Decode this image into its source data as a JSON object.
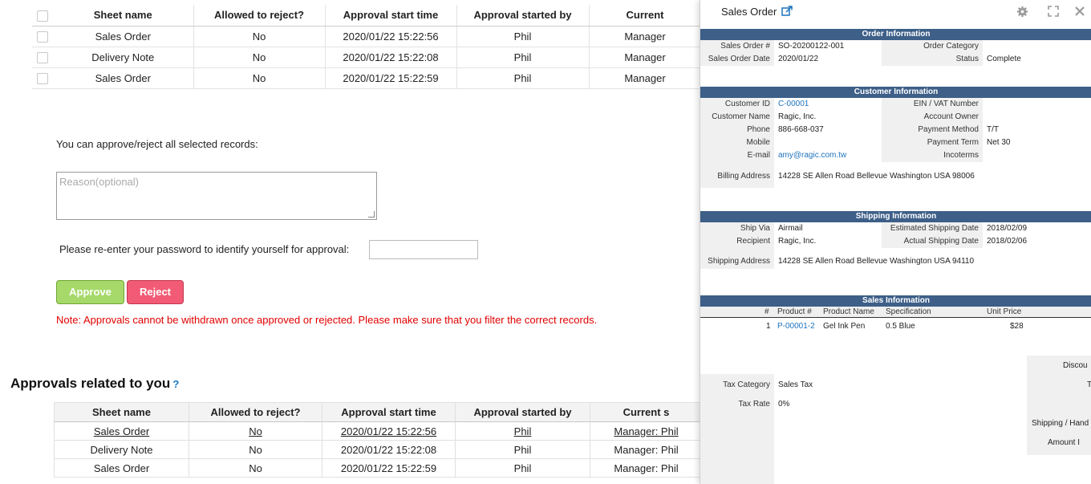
{
  "pending_table": {
    "headers": [
      "Sheet name",
      "Allowed to reject?",
      "Approval start time",
      "Approval started by",
      "Current"
    ],
    "rows": [
      [
        "Sales Order",
        "No",
        "2020/01/22 15:22:56",
        "Phil",
        "Manager"
      ],
      [
        "Delivery Note",
        "No",
        "2020/01/22 15:22:08",
        "Phil",
        "Manager"
      ],
      [
        "Sales Order",
        "No",
        "2020/01/22 15:22:59",
        "Phil",
        "Manager"
      ]
    ]
  },
  "approval_form": {
    "intro": "You can approve/reject all selected records:",
    "reason_placeholder": "Reason(optional)",
    "password_label": "Please re-enter your password to identify yourself for approval:",
    "approve_label": "Approve",
    "reject_label": "Reject",
    "note": "Note: Approvals cannot be withdrawn once approved or rejected. Please make sure that you filter the correct records."
  },
  "related": {
    "title": "Approvals related to you",
    "help": "?",
    "headers": [
      "Sheet name",
      "Allowed to reject?",
      "Approval start time",
      "Approval started by",
      "Current s"
    ],
    "rows": [
      [
        "Sales Order",
        "No",
        "2020/01/22 15:22:56",
        "Phil",
        "Manager: Phil"
      ],
      [
        "Delivery Note",
        "No",
        "2020/01/22 15:22:08",
        "Phil",
        "Manager: Phil"
      ],
      [
        "Sales Order",
        "No",
        "2020/01/22 15:22:59",
        "Phil",
        "Manager: Phil"
      ]
    ]
  },
  "panel": {
    "title": "Sales Order",
    "order_info": {
      "header": "Order Information",
      "sales_order_no_label": "Sales Order #",
      "sales_order_no": "SO-20200122-001",
      "sales_order_date_label": "Sales Order Date",
      "sales_order_date": "2020/01/22",
      "order_category_label": "Order Category",
      "order_category": "",
      "status_label": "Status",
      "status": "Complete"
    },
    "customer_info": {
      "header": "Customer Information",
      "customer_id_label": "Customer ID",
      "customer_id": "C-00001",
      "customer_name_label": "Customer Name",
      "customer_name": "Ragic, Inc.",
      "phone_label": "Phone",
      "phone": "886-668-037",
      "mobile_label": "Mobile",
      "mobile": "",
      "email_label": "E-mail",
      "email": "amy@ragic.com.tw",
      "billing_address_label": "Billing Address",
      "billing_address": "14228 SE Allen Road Bellevue Washington USA 98006",
      "ein_label": "EIN / VAT Number",
      "ein": "",
      "account_owner_label": "Account Owner",
      "account_owner": "",
      "payment_method_label": "Payment Method",
      "payment_method": "T/T",
      "payment_term_label": "Payment Term",
      "payment_term": "Net 30",
      "incoterms_label": "Incoterms",
      "incoterms": ""
    },
    "shipping_info": {
      "header": "Shipping Information",
      "ship_via_label": "Ship Via",
      "ship_via": "Airmail",
      "recipient_label": "Recipient",
      "recipient": "Ragic, Inc.",
      "shipping_address_label": "Shipping Address",
      "shipping_address": "14228 SE Allen Road Bellevue Washington USA 94110",
      "est_ship_date_label": "Estimated Shipping Date",
      "est_ship_date": "2018/02/09",
      "actual_ship_date_label": "Actual Shipping Date",
      "actual_ship_date": "2018/02/06"
    },
    "sales_info": {
      "header": "Sales Information",
      "columns": [
        "#",
        "Product #",
        "Product Name",
        "Specification",
        "Unit Price"
      ],
      "item": {
        "no": "1",
        "product_no": "P-00001-2",
        "product_name": "Gel Ink Pen",
        "spec": "0.5 Blue",
        "unit_price": "$28"
      }
    },
    "totals": {
      "discount_label": "Discou",
      "t_label": "T",
      "tax_category_label": "Tax Category",
      "tax_category": "Sales Tax",
      "tax_rate_label": "Tax Rate",
      "tax_rate": "0%",
      "shipping_label": "Shipping / Hand",
      "amount_label": "Amount I"
    }
  },
  "colors": {
    "section_bar": "#3d5f88",
    "approve": "#a6d96a",
    "reject": "#f25b75",
    "note": "#e00000",
    "link": "#1e73be"
  }
}
